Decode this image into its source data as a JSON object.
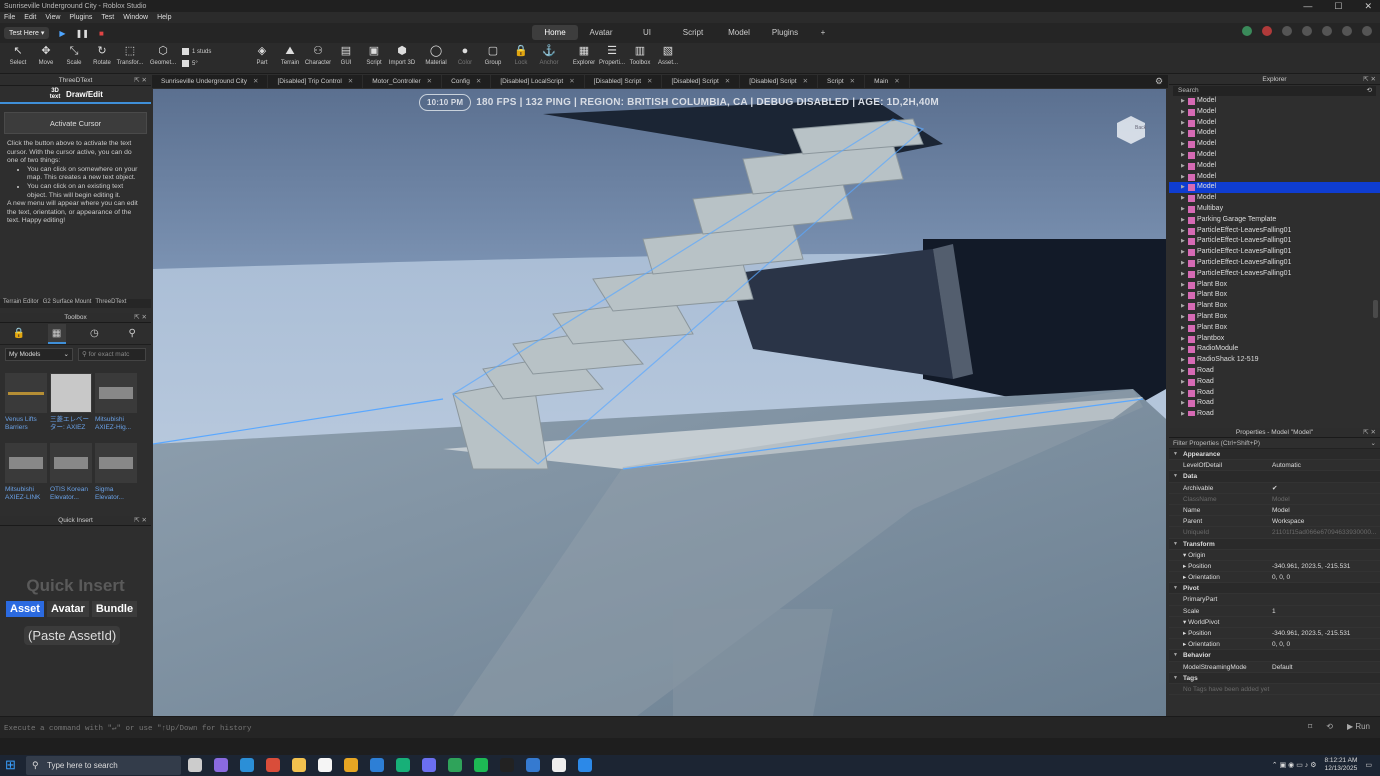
{
  "window": {
    "title": "Sunriseville Underground City - Roblox Studio"
  },
  "menu": [
    "File",
    "Edit",
    "View",
    "Plugins",
    "Test",
    "Window",
    "Help"
  ],
  "ribbon": {
    "test_dropdown": "Test Here ▾",
    "tabs": [
      "Home",
      "Avatar",
      "UI",
      "Script",
      "Model",
      "Plugins",
      "+"
    ],
    "active_tab": "Home"
  },
  "toolbar": {
    "tools": [
      "Select",
      "Move",
      "Scale",
      "Rotate",
      "Transfor...",
      "Geomet...",
      "Part",
      "Terrain",
      "Character",
      "GUI",
      "Script",
      "Import 3D",
      "Material",
      "Color",
      "Group",
      "Lock",
      "Anchor",
      "Explorer",
      "Properti...",
      "Toolbox",
      "Asset..."
    ],
    "studs": "1 studs",
    "angle": "5°"
  },
  "doc_tabs": [
    "Sunriseville Underground City",
    "[Disabled] Trip Control",
    "Motor_Controller",
    "Config",
    "[Disabled] LocalScript",
    "[Disabled] Script",
    "[Disabled] Script",
    "[Disabled] Script",
    "Script",
    "Main"
  ],
  "threedtext": {
    "panel_title": "ThreeDText",
    "mode": "Draw/Edit",
    "logo": "3D text",
    "activate_btn": "Activate Cursor",
    "p1": "Click the button above to activate the text cursor. With the cursor active, you can do one of two things:",
    "b1": "You can click on somewhere on your map. This creates a new text object.",
    "b2": "You can click on an existing text object. This will begin editing it.",
    "p2": "A new menu will appear where you can edit the text, orientation, or appearance of the text. Happy editing!",
    "bottom_tabs": [
      "Terrain Editor",
      "G2 Surface Mount",
      "ThreeDText"
    ]
  },
  "toolbox": {
    "title": "Toolbox",
    "category": "My Models",
    "search_placeholder": "for exact matc",
    "items": [
      "Venus Lifts Barriers",
      "三菱エレベーター: AXIEZ",
      "Mitsubishi AXIEZ-Hig...",
      "Mitsubishi AXIEZ-LINK",
      "OTIS Korean Elevator...",
      "Sigma Elevator..."
    ]
  },
  "quick_insert": {
    "title": "Quick Insert",
    "heading": "Quick Insert",
    "buttons": [
      "Asset",
      "Avatar",
      "Bundle"
    ],
    "paste": "(Paste AssetId)"
  },
  "viewport": {
    "time": "10:10 PM",
    "stats": "180 FPS | 132 PING | REGION: BRITISH COLUMBIA, CA | DEBUG DISABLED | AGE: 1D,2H,40M",
    "cube_label": "Back"
  },
  "explorer": {
    "title": "Explorer",
    "search": "Search",
    "selected_index": 8,
    "items": [
      "Model",
      "Model",
      "Model",
      "Model",
      "Model",
      "Model",
      "Model",
      "Model",
      "Model",
      "Model",
      "Multibay",
      "Parking Garage Template",
      "ParticleEffect-LeavesFalling01",
      "ParticleEffect-LeavesFalling01",
      "ParticleEffect-LeavesFalling01",
      "ParticleEffect-LeavesFalling01",
      "ParticleEffect-LeavesFalling01",
      "Plant Box",
      "Plant Box",
      "Plant Box",
      "Plant Box",
      "Plant Box",
      "Plantbox",
      "RadioModule",
      "RadioShack 12-519",
      "Road",
      "Road",
      "Road",
      "Road",
      "Road"
    ]
  },
  "properties": {
    "title": "Properties - Model \"Model\"",
    "filter": "Filter Properties (Ctrl+Shift+P)",
    "rows": [
      {
        "t": "cat",
        "n": "Appearance"
      },
      {
        "n": "LevelOfDetail",
        "v": "Automatic"
      },
      {
        "t": "cat",
        "n": "Data"
      },
      {
        "n": "Archivable",
        "v": "✔"
      },
      {
        "n": "ClassName",
        "v": "Model",
        "dim": true
      },
      {
        "n": "Name",
        "v": "Model"
      },
      {
        "n": "Parent",
        "v": "Workspace"
      },
      {
        "n": "UniqueId",
        "v": "21101f15ad066e67094633930000...",
        "dim": true
      },
      {
        "t": "cat",
        "n": "Transform"
      },
      {
        "n": "▾ Origin",
        "v": ""
      },
      {
        "n": "   ▸ Position",
        "v": "-340.961, 2023.5, -215.531"
      },
      {
        "n": "   ▸ Orientation",
        "v": "0, 0, 0"
      },
      {
        "t": "cat",
        "n": "Pivot"
      },
      {
        "n": "PrimaryPart",
        "v": ""
      },
      {
        "n": "Scale",
        "v": "1"
      },
      {
        "n": "▾ WorldPivot",
        "v": ""
      },
      {
        "n": "   ▸ Position",
        "v": "-340.961, 2023.5, -215.531"
      },
      {
        "n": "   ▸ Orientation",
        "v": "0, 0, 0"
      },
      {
        "t": "cat",
        "n": "Behavior"
      },
      {
        "n": "ModelStreamingMode",
        "v": "Default"
      },
      {
        "t": "cat",
        "n": "Tags"
      },
      {
        "n": "No Tags have been added yet",
        "v": "",
        "dim": true
      }
    ]
  },
  "command_bar": {
    "placeholder": "Execute a command with \"↵\" or use \"↑Up/Down for history",
    "run": "▶ Run"
  },
  "taskbar": {
    "search": "Type here to search",
    "time": "8:12:21 AM",
    "date": "12/13/2025"
  }
}
